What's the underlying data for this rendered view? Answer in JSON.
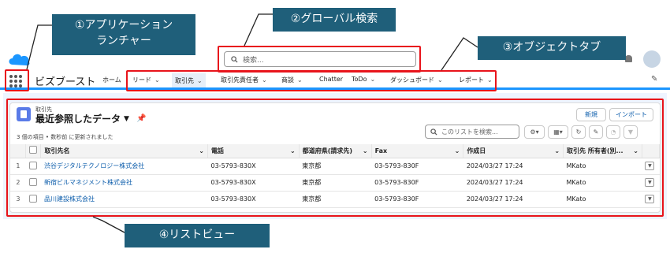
{
  "annotations": [
    {
      "line1": "①アプリケーション",
      "line2": "ランチャー"
    },
    {
      "label": "②グローバル検索"
    },
    {
      "label": "③オブジェクトタブ"
    },
    {
      "label": "④リストビュー"
    }
  ],
  "header": {
    "search_placeholder": "検索..."
  },
  "app": {
    "name": "ビズブースト",
    "tabs": [
      {
        "label": "ホーム",
        "has_menu": false
      },
      {
        "label": "リード",
        "has_menu": true
      },
      {
        "label": "取引先",
        "has_menu": true,
        "active": true
      },
      {
        "label": "取引先責任者",
        "has_menu": true
      },
      {
        "label": "商談",
        "has_menu": true
      },
      {
        "label": "Chatter",
        "has_menu": false
      },
      {
        "label": "ToDo",
        "has_menu": true
      },
      {
        "label": "ダッシュボード",
        "has_menu": true
      },
      {
        "label": "レポート",
        "has_menu": true
      }
    ]
  },
  "list_view": {
    "object_label": "取引先",
    "title": "最近参照したデータ",
    "new_button": "新規",
    "import_button": "インポート",
    "meta_text": "3 個の項目 • 数秒前 に更新されました",
    "search_placeholder": "このリストを検索...",
    "columns": [
      "取引先名",
      "電話",
      "都道府県(請求先)",
      "Fax",
      "作成日",
      "取引先 所有者(別..."
    ],
    "rows": [
      {
        "num": "1",
        "name": "渋谷デジタルテクノロジー株式会社",
        "phone": "03-5793-830X",
        "pref": "東京都",
        "fax": "03-5793-830F",
        "created": "2024/03/27 17:24",
        "owner": "MKato"
      },
      {
        "num": "2",
        "name": "新宿ビルマネジメント株式会社",
        "phone": "03-5793-830X",
        "pref": "東京都",
        "fax": "03-5793-830F",
        "created": "2024/03/27 17:24",
        "owner": "MKato"
      },
      {
        "num": "3",
        "name": "品川建設株式会社",
        "phone": "03-5793-830X",
        "pref": "東京都",
        "fax": "03-5793-830F",
        "created": "2024/03/27 17:24",
        "owner": "MKato"
      }
    ]
  },
  "colors": {
    "callout_bg": "#1f5f7a",
    "highlight_border": "#e8141b",
    "brand_blue": "#1b96ff",
    "link": "#0b5cab"
  },
  "icons": [
    "salesforce-cloud-icon",
    "app-launcher-icon",
    "search-icon",
    "pin-icon",
    "gear-icon",
    "table-icon",
    "refresh-icon",
    "edit-icon",
    "chart-icon",
    "filter-icon",
    "dropdown-icon",
    "bell-icon",
    "avatar-icon"
  ]
}
